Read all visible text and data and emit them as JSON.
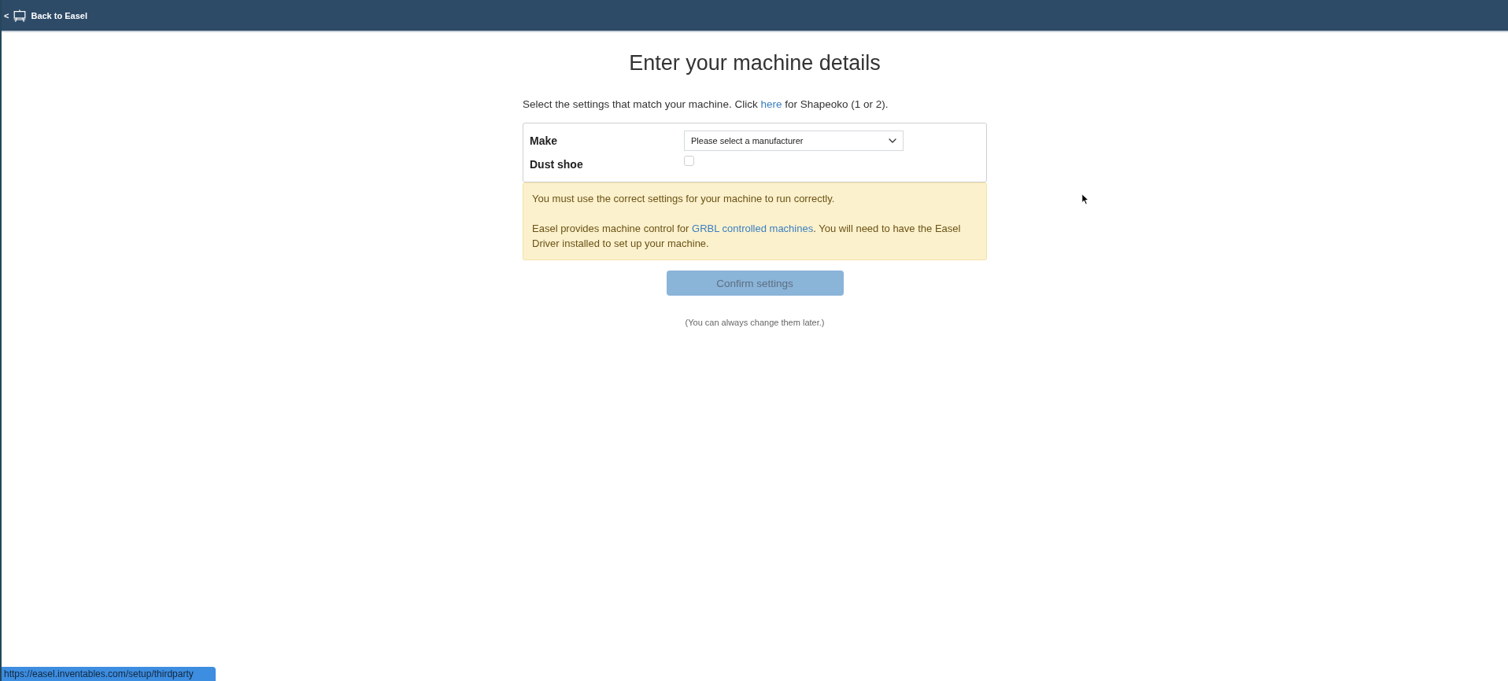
{
  "top_bar": {
    "back_link": {
      "arrow": "<",
      "label": "Back to Easel"
    }
  },
  "title": "Enter your machine details",
  "intro": [
    {
      "kind": "text",
      "text": "Select the settings that match your machine. Click "
    },
    {
      "kind": "link",
      "text": "here"
    },
    {
      "kind": "text",
      "text": " for Shapeoko (1 or 2)."
    }
  ],
  "form": {
    "fields": [
      {
        "kind": "select",
        "label": "Make",
        "value": "Please select a manufacturer"
      },
      {
        "kind": "checkbox",
        "label": "Dust shoe",
        "checked": false
      }
    ]
  },
  "notice": {
    "paragraphs": [
      [
        {
          "kind": "text",
          "text": "You must use the correct settings for your machine to run correctly."
        }
      ],
      [
        {
          "kind": "text",
          "text": "Easel provides machine control for "
        },
        {
          "kind": "link",
          "text": "GRBL controlled machines"
        },
        {
          "kind": "text",
          "text": ". You will need to have the Easel Driver installed to set up your machine."
        }
      ]
    ]
  },
  "confirm_button": {
    "label": "Confirm settings",
    "disabled": true
  },
  "note": "(You can always change them later.)",
  "status_bar": {
    "url": "https://easel.inventables.com/setup/thirdparty"
  }
}
